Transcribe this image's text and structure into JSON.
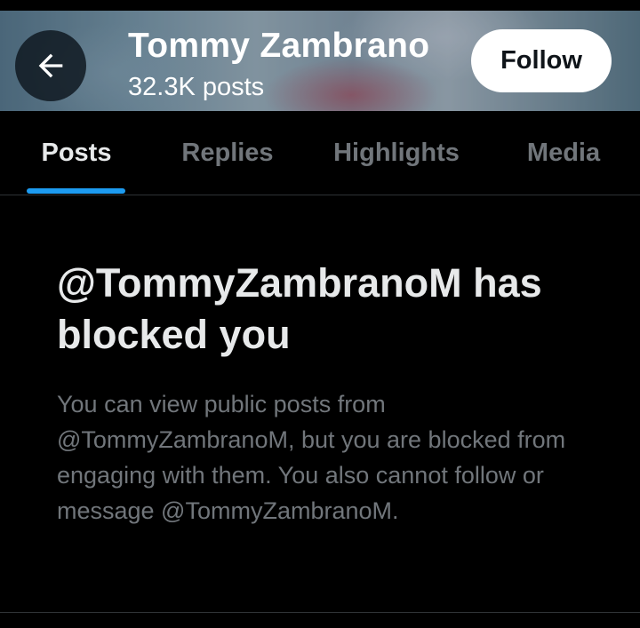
{
  "header": {
    "name": "Tommy Zambrano",
    "post_count": "32.3K posts",
    "follow_label": "Follow",
    "back_icon": "arrow-left-icon"
  },
  "tabs": [
    {
      "label": "Posts",
      "active": true
    },
    {
      "label": "Replies",
      "active": false
    },
    {
      "label": "Highlights",
      "active": false
    },
    {
      "label": "Media",
      "active": false
    }
  ],
  "blocked": {
    "title": "@TommyZambranoM has blocked you",
    "description": "You can view public posts from @TommyZambranoM, but you are blocked from engaging with them. You also cannot follow or message @TommyZambranoM."
  },
  "colors": {
    "accent": "#1d9bf0",
    "background": "#000000",
    "text_primary": "#e7e9ea",
    "text_secondary": "#71767b"
  }
}
